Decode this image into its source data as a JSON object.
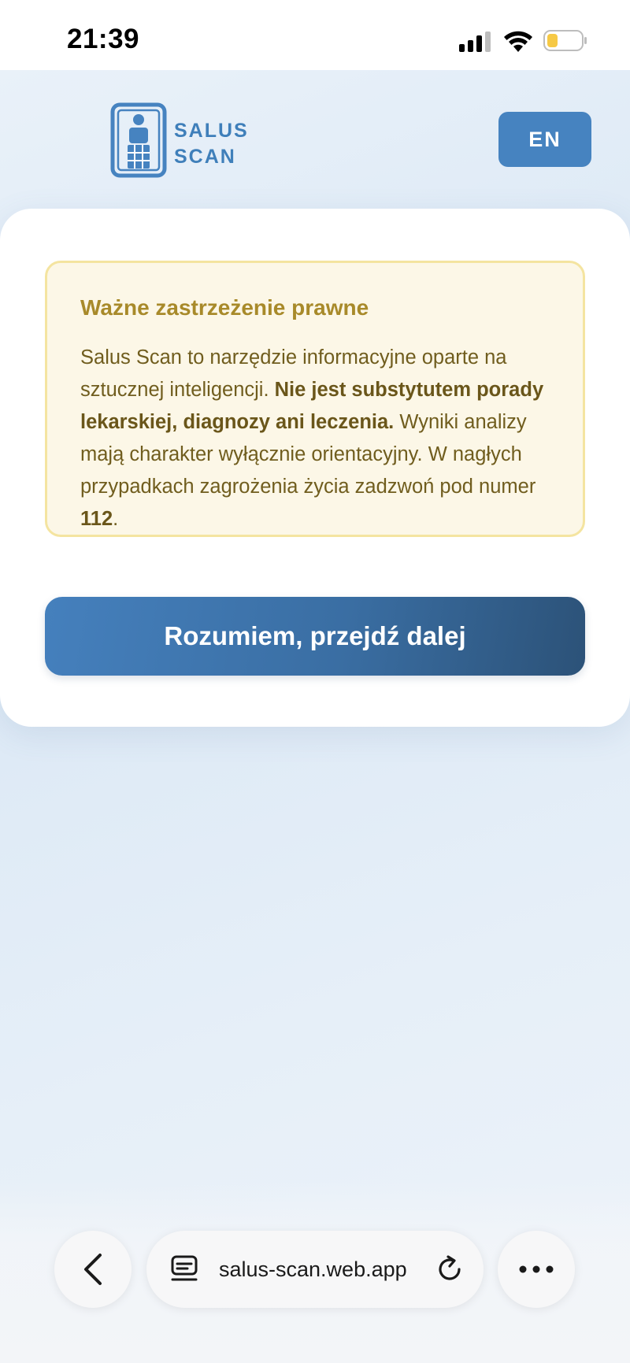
{
  "status_bar": {
    "time": "21:39",
    "icons": [
      "cellular-signal-icon",
      "wifi-icon",
      "battery-low-icon"
    ],
    "battery_color": "#f6c945"
  },
  "header": {
    "logo_line1": "SALUS",
    "logo_line2": "SCAN",
    "lang_button": "EN",
    "brand_color": "#3f7fba"
  },
  "disclaimer": {
    "title": "Ważne zastrzeżenie prawne",
    "text_1": "Salus Scan to narzędzie informacyjne oparte na sztucznej inteligencji. ",
    "text_bold": "Nie jest substytutem porady lekarskiej, diagnozy ani leczenia.",
    "text_2": " Wyniki analizy mają charakter wyłącznie orientacyjny. W nagłych przypadkach zagrożenia życia zadzwoń pod numer ",
    "emergency_number": "112",
    "text_end": ".",
    "background_color": "#fcf7e7",
    "border_color": "#f4e4a0"
  },
  "cta": {
    "label": "Rozumiem, przejdź dalej"
  },
  "browser": {
    "url": "salus-scan.web.app",
    "icons": [
      "back-chevron-icon",
      "tabs-icon",
      "reload-icon",
      "more-icon"
    ]
  }
}
